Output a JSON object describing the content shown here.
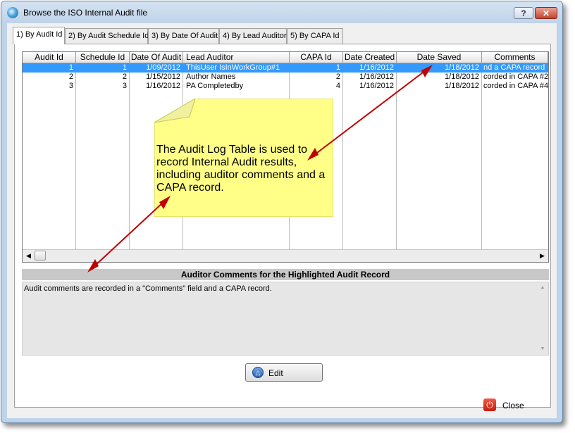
{
  "window": {
    "title": "Browse the ISO Internal Audit file",
    "help_label": "?",
    "close_label": "✕"
  },
  "tabs": [
    {
      "label": "1) By Audit Id"
    },
    {
      "label": "2) By Audit Schedule Id"
    },
    {
      "label": "3) By Date Of Audit"
    },
    {
      "label": "4) By Lead Auditor"
    },
    {
      "label": "5) By CAPA Id"
    }
  ],
  "table": {
    "columns": [
      "Audit Id",
      "Schedule Id",
      "Date Of Audit",
      "Lead Auditor",
      "CAPA Id",
      "Date Created",
      "Date Saved",
      "Comments"
    ],
    "rows": [
      [
        "1",
        "1",
        "1/09/2012",
        "ThisUser IsInWorkGroup#1",
        "1",
        "1/16/2012",
        "1/18/2012",
        "nd a CAPA record"
      ],
      [
        "2",
        "2",
        "1/15/2012",
        "Author Names",
        "2",
        "1/16/2012",
        "1/18/2012",
        "corded in CAPA #2"
      ],
      [
        "3",
        "3",
        "1/16/2012",
        "PA Completedby",
        "4",
        "1/16/2012",
        "1/18/2012",
        "corded in CAPA #4"
      ]
    ]
  },
  "comments": {
    "header": "Auditor Comments for the Highlighted Audit Record",
    "text": "Audit comments are recorded in a \"Comments\" field and a CAPA record."
  },
  "buttons": {
    "edit": "Edit",
    "close": "Close"
  },
  "callout": {
    "text": "The Audit Log Table is used to record Internal Audit results, including auditor comments and a CAPA record."
  },
  "colors": {
    "selection": "#3399ff",
    "callout_fill": "#ffff88",
    "arrow": "#c00000"
  }
}
